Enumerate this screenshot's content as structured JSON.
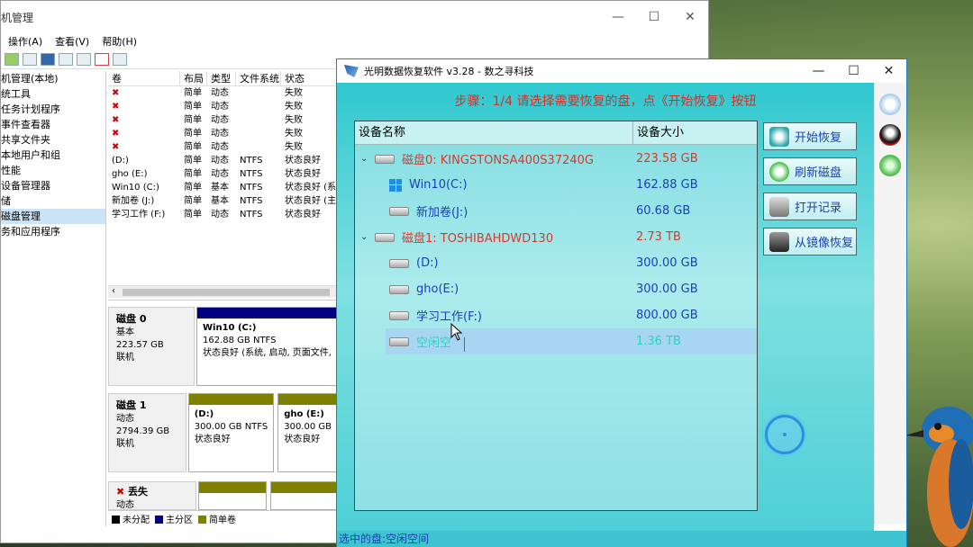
{
  "cm": {
    "title": "机管理",
    "controls": [
      "—",
      "☐",
      "✕"
    ],
    "menu": [
      "操作(A)",
      "查看(V)",
      "帮助(H)"
    ],
    "tree": [
      {
        "label": "机管理(本地)",
        "selected": false
      },
      {
        "label": "统工具",
        "selected": false
      },
      {
        "label": "任务计划程序",
        "selected": false
      },
      {
        "label": "事件查看器",
        "selected": false
      },
      {
        "label": "共享文件夹",
        "selected": false
      },
      {
        "label": "本地用户和组",
        "selected": false
      },
      {
        "label": "性能",
        "selected": false
      },
      {
        "label": "设备管理器",
        "selected": false
      },
      {
        "label": "储",
        "selected": false
      },
      {
        "label": "磁盘管理",
        "selected": true
      },
      {
        "label": "务和应用程序",
        "selected": false
      }
    ],
    "vol_headers": [
      "卷",
      "布局",
      "类型",
      "文件系统",
      "状态"
    ],
    "vol_rows": [
      [
        "",
        "简单",
        "动态",
        "",
        "失败"
      ],
      [
        "",
        "简单",
        "动态",
        "",
        "失败"
      ],
      [
        "",
        "简单",
        "动态",
        "",
        "失败"
      ],
      [
        "",
        "简单",
        "动态",
        "",
        "失败"
      ],
      [
        "",
        "简单",
        "动态",
        "",
        "失败"
      ],
      [
        "(D:)",
        "简单",
        "动态",
        "NTFS",
        "状态良好"
      ],
      [
        "gho (E:)",
        "简单",
        "动态",
        "NTFS",
        "状态良好"
      ],
      [
        "Win10 (C:)",
        "简单",
        "基本",
        "NTFS",
        "状态良好 (系"
      ],
      [
        "新加卷 (J:)",
        "简单",
        "基本",
        "NTFS",
        "状态良好 (主"
      ],
      [
        "学习工作 (F:)",
        "简单",
        "动态",
        "NTFS",
        "状态良好"
      ]
    ],
    "disk0": {
      "name": "磁盘 0",
      "type": "基本",
      "size": "223.57 GB",
      "state": "联机",
      "part_label": "Win10  (C:)",
      "part_size": "162.88 GB NTFS",
      "part_status": "状态良好 (系统, 启动, 页面文件,"
    },
    "disk1": {
      "name": "磁盘 1",
      "type": "动态",
      "size": "2794.39 GB",
      "state": "联机",
      "p1_label": "(D:)",
      "p1_size": "300.00 GB NTFS",
      "p1_status": "状态良好",
      "p2_label": "gho  (E:)",
      "p2_size": "300.00 GB",
      "p2_status": "状态良好"
    },
    "disk2": {
      "name": "丢失",
      "type": "动态"
    },
    "legend": [
      "未分配",
      "主分区",
      "简单卷"
    ],
    "legend_colors": [
      "#000000",
      "#000080",
      "#808000"
    ]
  },
  "app": {
    "title": "光明数据恢复软件 v3.28 - 数之寻科技",
    "controls": [
      "—",
      "☐",
      "✕"
    ],
    "step": "步骤：1/4 请选择需要恢复的盘，点《开始恢复》按钮",
    "col_name": "设备名称",
    "col_size": "设备大小",
    "rows": [
      {
        "kind": "disk",
        "name": "磁盘0: KINGSTONSA400S37240G",
        "size": "223.58 GB"
      },
      {
        "kind": "win",
        "name": "Win10(C:)",
        "size": "162.88 GB"
      },
      {
        "kind": "part",
        "name": "新加卷(J:)",
        "size": "60.68 GB"
      },
      {
        "kind": "disk",
        "name": "磁盘1: TOSHIBAHDWD130",
        "size": "2.73 TB"
      },
      {
        "kind": "part",
        "name": "(D:)",
        "size": "300.00 GB"
      },
      {
        "kind": "part",
        "name": "gho(E:)",
        "size": "300.00 GB"
      },
      {
        "kind": "part",
        "name": "学习工作(F:)",
        "size": "800.00 GB"
      },
      {
        "kind": "selected",
        "name": "空闲空",
        "size": "1.36 TB"
      }
    ],
    "buttons": [
      "开始恢复",
      "刷新磁盘",
      "打开记录",
      "从镜像恢复"
    ],
    "status": "选中的盘:空闲空间",
    "colors": {
      "accent": "#1a3fb2",
      "disk_text": "#d63a2e",
      "step": "#d6302a"
    }
  }
}
